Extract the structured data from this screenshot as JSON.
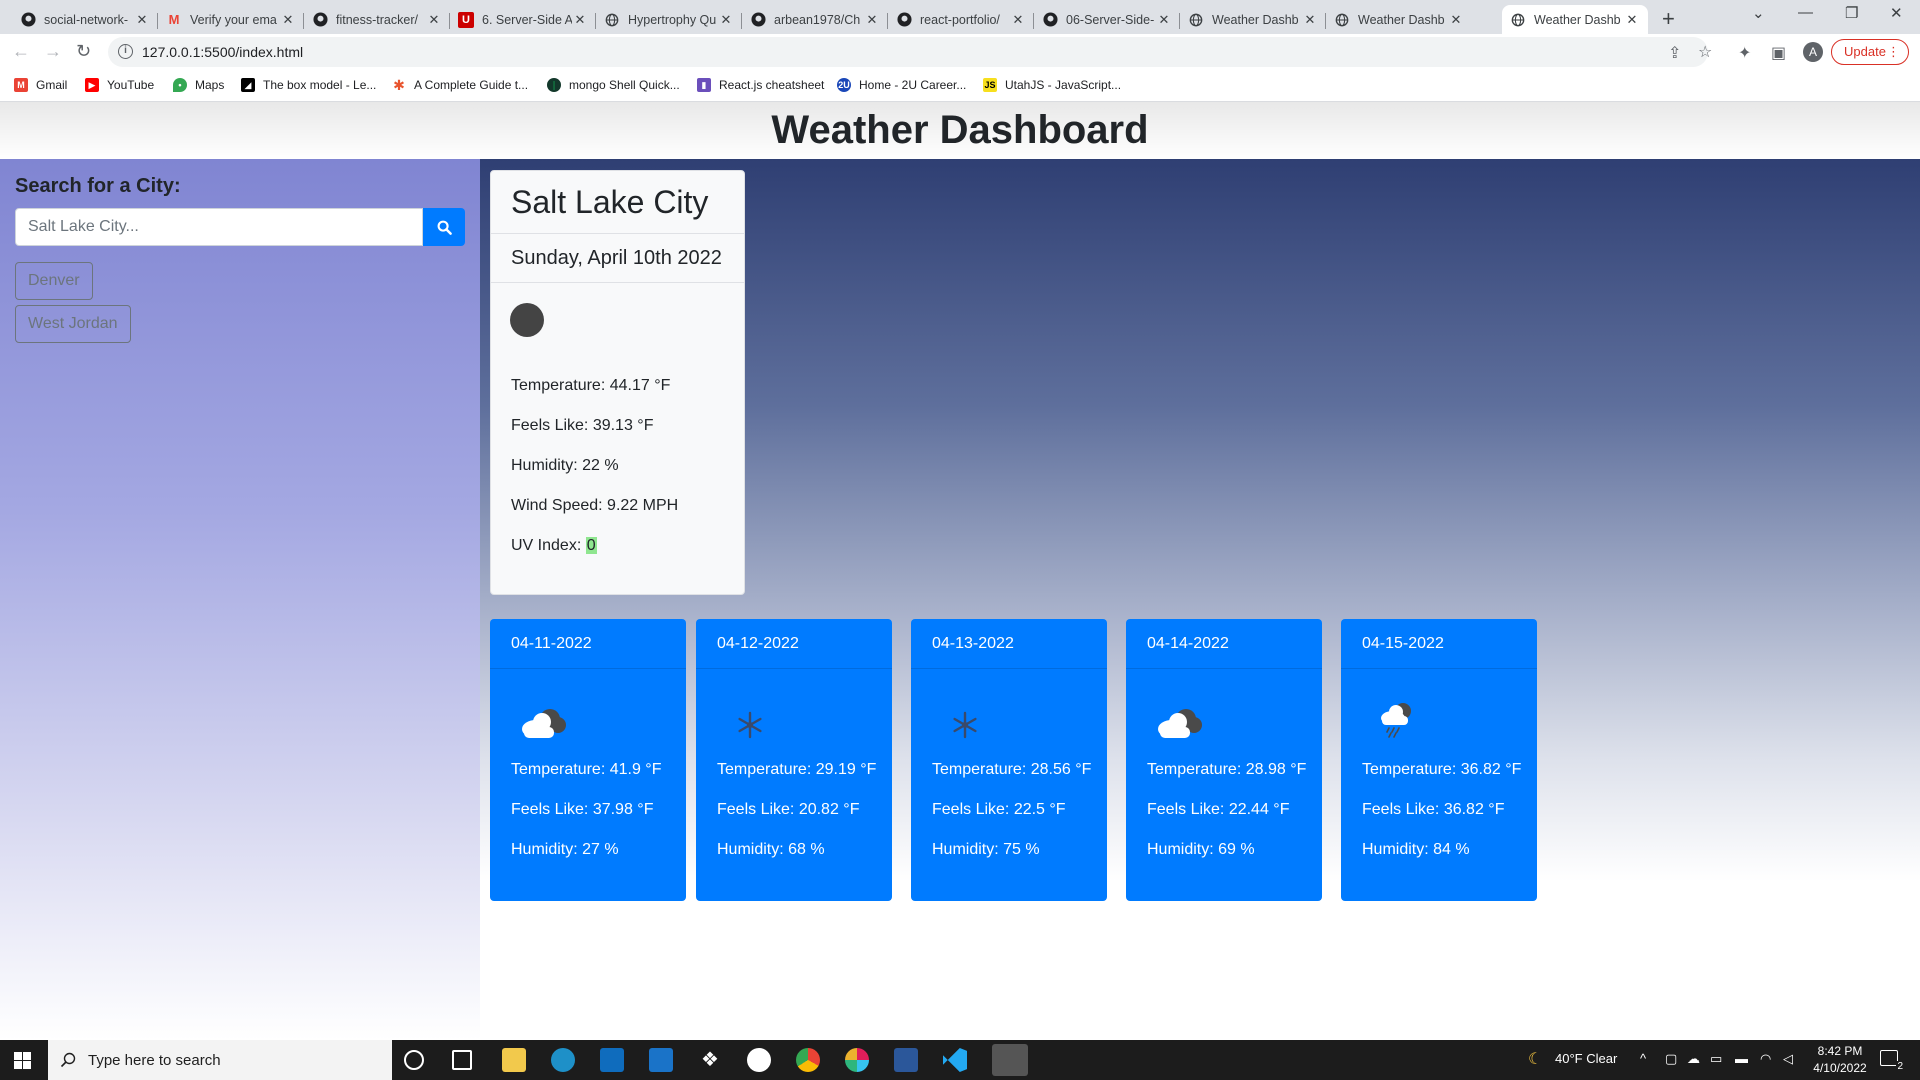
{
  "browser": {
    "tabs": [
      {
        "title": "social-network-",
        "icon": "github-icon"
      },
      {
        "title": "Verify your ema",
        "icon": "gmail-icon"
      },
      {
        "title": "fitness-tracker/",
        "icon": "github-icon"
      },
      {
        "title": "6. Server-Side A",
        "icon": "utah-u-icon"
      },
      {
        "title": "Hypertrophy Qu",
        "icon": "globe-icon"
      },
      {
        "title": "arbean1978/Ch",
        "icon": "github-icon"
      },
      {
        "title": "react-portfolio/",
        "icon": "github-icon"
      },
      {
        "title": "06-Server-Side-",
        "icon": "github-icon"
      },
      {
        "title": "Weather Dashb",
        "icon": "globe-icon"
      },
      {
        "title": "Weather Dashb",
        "icon": "globe-icon"
      },
      {
        "title": "Weather Dashb",
        "icon": "globe-icon"
      }
    ],
    "url": "127.0.0.1:5500/index.html",
    "profile_initial": "A",
    "update_label": "Update",
    "bookmarks": [
      {
        "label": "Gmail",
        "icon": "gmail-icon",
        "color": "#ea4335"
      },
      {
        "label": "YouTube",
        "icon": "youtube-icon",
        "color": "#ff0000"
      },
      {
        "label": "Maps",
        "icon": "maps-icon",
        "color": "#34a853"
      },
      {
        "label": "The box model - Le...",
        "icon": "mdn-icon",
        "color": "#000000"
      },
      {
        "label": "A Complete Guide t...",
        "icon": "css-tricks-icon",
        "color": "#e8542e"
      },
      {
        "label": "mongo Shell Quick...",
        "icon": "mongodb-icon",
        "color": "#13aa52"
      },
      {
        "label": "React.js cheatsheet",
        "icon": "devhints-icon",
        "color": "#6b4fbb"
      },
      {
        "label": "Home - 2U Career...",
        "icon": "2u-icon",
        "color": "#1a47b8"
      },
      {
        "label": "UtahJS - JavaScript...",
        "icon": "js-icon",
        "color": "#f7df1e"
      }
    ]
  },
  "page": {
    "title": "Weather Dashboard",
    "search": {
      "label": "Search for a City:",
      "placeholder": "Salt Lake City..."
    },
    "history": [
      "Denver",
      "West Jordan"
    ],
    "current": {
      "city": "Salt Lake City",
      "date": "Sunday, April 10th 2022",
      "temperature": "Temperature: 44.17 °F",
      "feels_like": "Feels Like: 39.13 °F",
      "humidity": "Humidity: 22 %",
      "wind": "Wind Speed: 9.22 MPH",
      "uv_label": "UV Index: ",
      "uv_value": "0",
      "uv_color": "#8fe68f"
    },
    "forecast": [
      {
        "date": "04-11-2022",
        "icon": "cloudy-icon",
        "temperature": "Temperature: 41.9 °F",
        "feels_like": "Feels Like: 37.98 °F",
        "humidity": "Humidity: 27 %"
      },
      {
        "date": "04-12-2022",
        "icon": "snow-icon",
        "temperature": "Temperature: 29.19 °F",
        "feels_like": "Feels Like: 20.82 °F",
        "humidity": "Humidity: 68 %"
      },
      {
        "date": "04-13-2022",
        "icon": "snow-icon",
        "temperature": "Temperature: 28.56 °F",
        "feels_like": "Feels Like: 22.5 °F",
        "humidity": "Humidity: 75 %"
      },
      {
        "date": "04-14-2022",
        "icon": "cloudy-icon",
        "temperature": "Temperature: 28.98 °F",
        "feels_like": "Feels Like: 22.44 °F",
        "humidity": "Humidity: 69 %"
      },
      {
        "date": "04-15-2022",
        "icon": "rain-icon",
        "temperature": "Temperature: 36.82 °F",
        "feels_like": "Feels Like: 36.82 °F",
        "humidity": "Humidity: 84 %"
      }
    ],
    "accent_color": "#007bff"
  },
  "taskbar": {
    "search_placeholder": "Type here to search",
    "weather": "40°F  Clear",
    "time": "8:42 PM",
    "date": "4/10/2022",
    "notifications": "2"
  }
}
